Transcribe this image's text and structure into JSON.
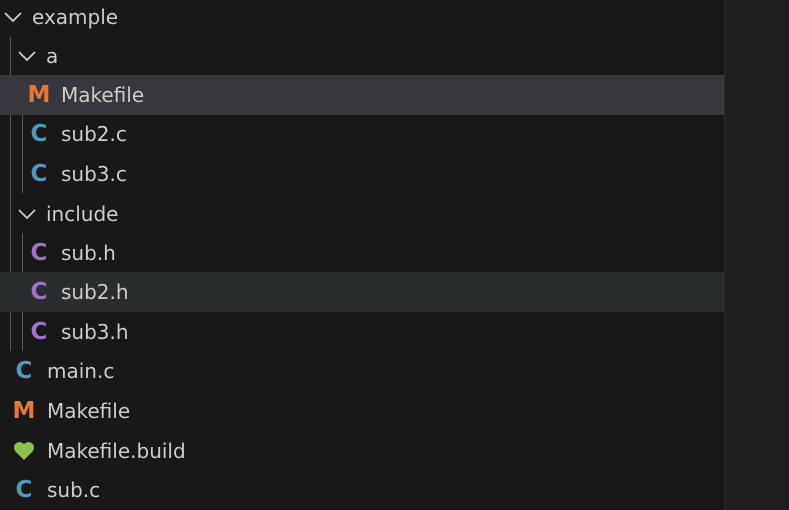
{
  "colors": {
    "c_source": "#519aba",
    "c_header": "#a074c4",
    "makefile": "#e37933",
    "build": "#8dc149"
  },
  "tree": {
    "root": {
      "label": "example",
      "icon": "chevron-down-icon"
    },
    "folder_a": {
      "label": "a",
      "icon": "chevron-down-icon"
    },
    "a_makefile": {
      "label": "Makefile",
      "icon": "makefile-icon",
      "glyph": "M"
    },
    "a_sub2c": {
      "label": "sub2.c",
      "icon": "c-file-icon",
      "glyph": "C"
    },
    "a_sub3c": {
      "label": "sub3.c",
      "icon": "c-file-icon",
      "glyph": "C"
    },
    "folder_include": {
      "label": "include",
      "icon": "chevron-down-icon"
    },
    "inc_subh": {
      "label": "sub.h",
      "icon": "header-file-icon",
      "glyph": "C"
    },
    "inc_sub2h": {
      "label": "sub2.h",
      "icon": "header-file-icon",
      "glyph": "C"
    },
    "inc_sub3h": {
      "label": "sub3.h",
      "icon": "header-file-icon",
      "glyph": "C"
    },
    "main_c": {
      "label": "main.c",
      "icon": "c-file-icon",
      "glyph": "C"
    },
    "makefile": {
      "label": "Makefile",
      "icon": "makefile-icon",
      "glyph": "M"
    },
    "makefile_build": {
      "label": "Makefile.build",
      "icon": "heart-icon"
    },
    "sub_c": {
      "label": "sub.c",
      "icon": "c-file-icon",
      "glyph": "C"
    }
  }
}
